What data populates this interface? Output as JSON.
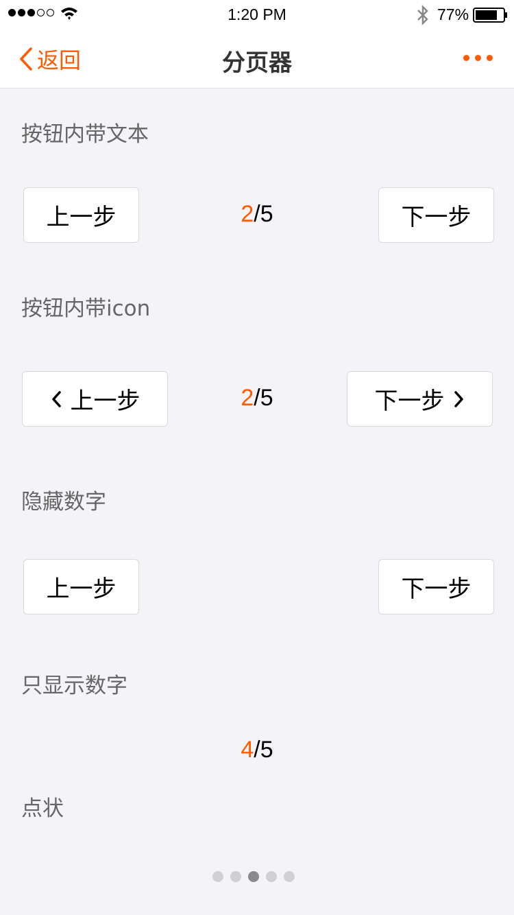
{
  "status_bar": {
    "time": "1:20 PM",
    "battery": "77%"
  },
  "nav": {
    "back_label": "返回",
    "title": "分页器"
  },
  "sections": {
    "text_buttons": {
      "title": "按钮内带文本",
      "prev": "上一步",
      "next": "下一步",
      "current": "2",
      "total": "/5"
    },
    "icon_buttons": {
      "title": "按钮内带icon",
      "prev": "上一步",
      "next": "下一步",
      "current": "2",
      "total": "/5"
    },
    "hide_number": {
      "title": "隐藏数字",
      "prev": "上一步",
      "next": "下一步"
    },
    "number_only": {
      "title": "只显示数字",
      "current": "4",
      "total": "/5"
    },
    "dots": {
      "title": "点状",
      "count": 5,
      "active_index": 2
    }
  },
  "colors": {
    "accent": "#ff5a00",
    "background": "#f4f4f8"
  }
}
